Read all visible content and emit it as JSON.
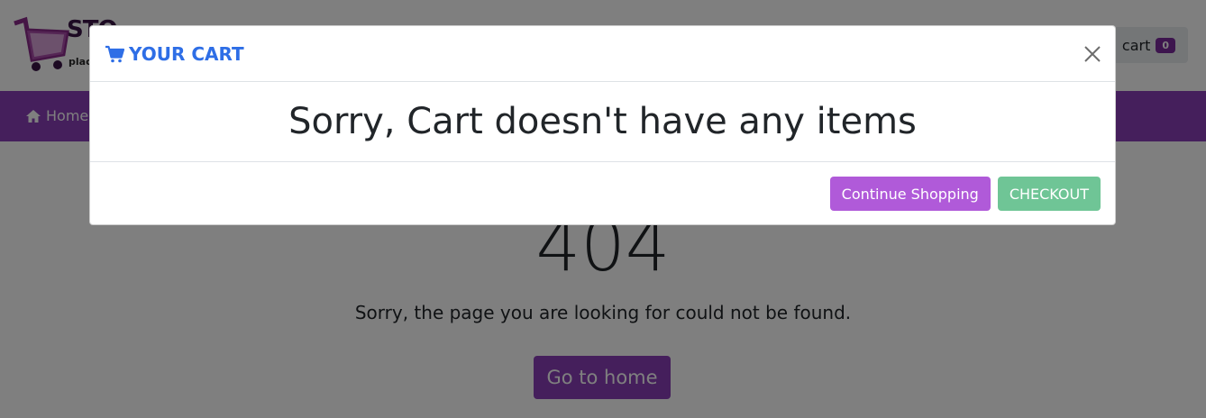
{
  "header": {
    "logo_text": "STO",
    "logo_sub": "plac",
    "cart_label": "cart",
    "cart_count": "0"
  },
  "navbar": {
    "home_label": "Home"
  },
  "main": {
    "error_code": "404",
    "message": "Sorry, the page you are looking for could not be found.",
    "home_button": "Go to home"
  },
  "modal": {
    "title": "YOUR CART",
    "message": "Sorry, Cart doesn't have any items",
    "continue_label": "Continue Shopping",
    "checkout_label": "CHECKOUT"
  },
  "colors": {
    "brand_purple": "#8a3fb8",
    "title_blue": "#2e6ee6",
    "continue_purple": "#b05ad9",
    "checkout_green": "#6fc596"
  }
}
